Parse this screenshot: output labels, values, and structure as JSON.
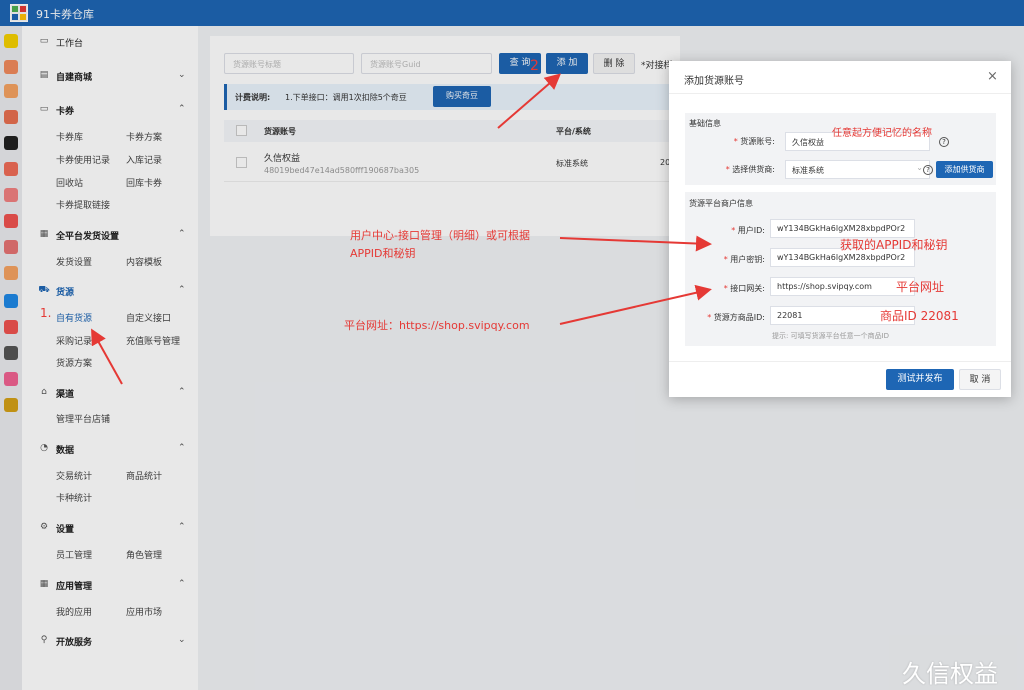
{
  "app": {
    "title": "91卡券仓库"
  },
  "sidebar": {
    "workbench": "工作台",
    "groups": [
      {
        "label": "自建商城",
        "links": []
      },
      {
        "label": "卡券",
        "links": [
          "卡券库",
          "卡券方案",
          "卡券使用记录",
          "入库记录",
          "回收站",
          "回库卡券",
          "卡券提取链接"
        ]
      },
      {
        "label": "全平台发货设置",
        "links": [
          "发货设置",
          "内容模板"
        ]
      },
      {
        "label": "货源",
        "links": [
          "自有货源",
          "自定义接口",
          "采购记录",
          "充值账号管理",
          "货源方案"
        ]
      },
      {
        "label": "渠道",
        "links": [
          "管理平台店铺"
        ]
      },
      {
        "label": "数据",
        "links": [
          "交易统计",
          "商品统计",
          "卡种统计"
        ]
      },
      {
        "label": "设置",
        "links": [
          "员工管理",
          "角色管理"
        ]
      },
      {
        "label": "应用管理",
        "links": [
          "我的应用",
          "应用市场"
        ]
      },
      {
        "label": "开放服务",
        "links": []
      }
    ]
  },
  "toolbar": {
    "title_placeholder": "货源账号标题",
    "guid_placeholder": "货源账号Guid",
    "query": "查 询",
    "add": "添 加",
    "delete": "删 除",
    "tail_text": "*对接样"
  },
  "billing": {
    "label": "计费说明:",
    "text": "1.下单接口：调用1次扣除5个奇豆",
    "button": "购买奇豆"
  },
  "table": {
    "headers": [
      "货源账号",
      "平台/系统"
    ],
    "rows": [
      {
        "name": "久信权益",
        "guid": "48019bed47e14ad580fff190687ba305",
        "platform": "标准系统",
        "extra": "20"
      }
    ]
  },
  "modal": {
    "title": "添加货源账号",
    "basic_section": "基础信息",
    "account_label": "货源账号:",
    "account_value": "久信权益",
    "supplier_label": "选择供货商:",
    "supplier_value": "标准系统",
    "add_supplier": "添加供货商",
    "merchant_section": "货源平台商户信息",
    "user_id_label": "用户ID:",
    "user_id_value": "wY134BGkHa6lgXM28xbpdPOr2",
    "user_secret_label": "用户密钥:",
    "user_secret_value": "wY134BGkHa6lgXM28xbpdPOr2",
    "gateway_label": "接口网关:",
    "gateway_value": "https://shop.svipqy.com",
    "product_id_label": "货源方商品ID:",
    "product_id_value": "22081",
    "hint": "提示: 可填写货源平台任意一个商品ID",
    "submit": "测试并发布",
    "cancel": "取 消"
  },
  "annotations": {
    "name_hint": "任意起方便记忆的名称",
    "appid_hint": "获取的APPID和秘钥",
    "gateway_hint": "平台网址",
    "product_hint": "商品ID 22081",
    "user_center_line1": "用户中心-接口管理（明细）或可根据",
    "user_center_line2": "APPID和秘钥",
    "platform_url": "平台网址：https://shop.svipqy.com",
    "step1": "1.",
    "step2": "2"
  },
  "watermark": "久信权益",
  "colors": {
    "primary": "#1e66b4",
    "annotation": "#e53935",
    "required": "#e53935"
  }
}
